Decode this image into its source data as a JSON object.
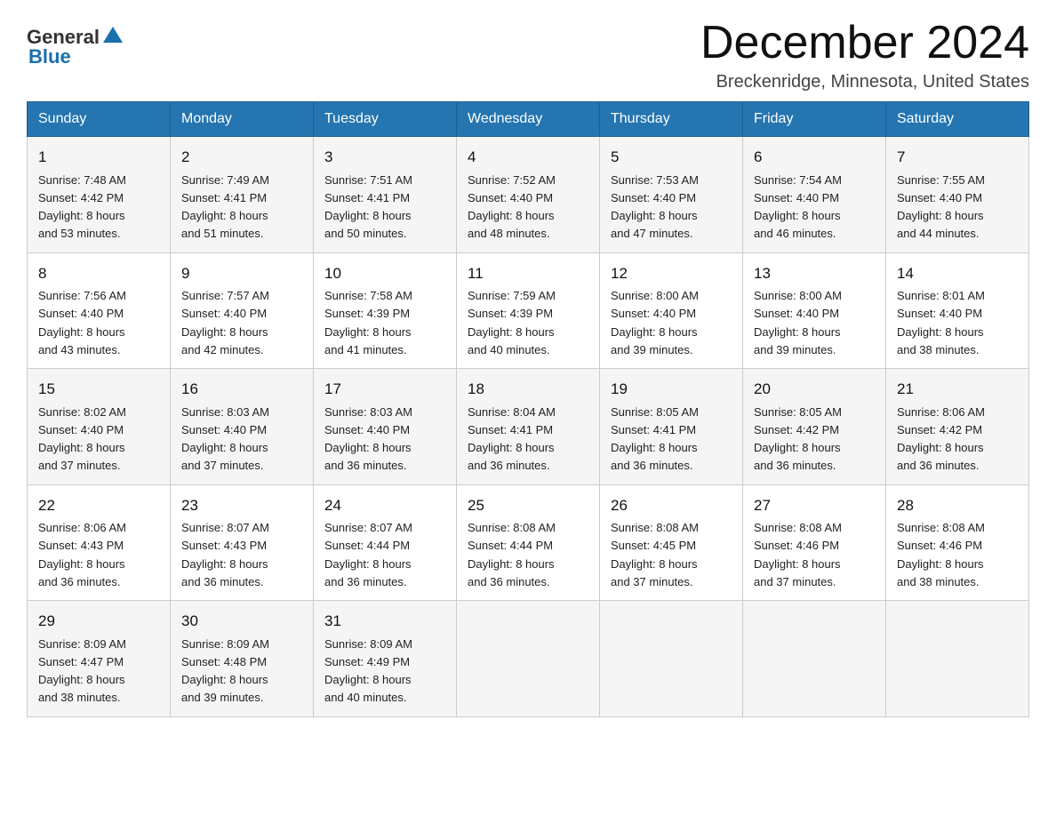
{
  "logo": {
    "general": "General",
    "blue": "Blue"
  },
  "title": "December 2024",
  "location": "Breckenridge, Minnesota, United States",
  "days_of_week": [
    "Sunday",
    "Monday",
    "Tuesday",
    "Wednesday",
    "Thursday",
    "Friday",
    "Saturday"
  ],
  "weeks": [
    [
      {
        "day": "1",
        "sunrise": "7:48 AM",
        "sunset": "4:42 PM",
        "daylight": "8 hours and 53 minutes."
      },
      {
        "day": "2",
        "sunrise": "7:49 AM",
        "sunset": "4:41 PM",
        "daylight": "8 hours and 51 minutes."
      },
      {
        "day": "3",
        "sunrise": "7:51 AM",
        "sunset": "4:41 PM",
        "daylight": "8 hours and 50 minutes."
      },
      {
        "day": "4",
        "sunrise": "7:52 AM",
        "sunset": "4:40 PM",
        "daylight": "8 hours and 48 minutes."
      },
      {
        "day": "5",
        "sunrise": "7:53 AM",
        "sunset": "4:40 PM",
        "daylight": "8 hours and 47 minutes."
      },
      {
        "day": "6",
        "sunrise": "7:54 AM",
        "sunset": "4:40 PM",
        "daylight": "8 hours and 46 minutes."
      },
      {
        "day": "7",
        "sunrise": "7:55 AM",
        "sunset": "4:40 PM",
        "daylight": "8 hours and 44 minutes."
      }
    ],
    [
      {
        "day": "8",
        "sunrise": "7:56 AM",
        "sunset": "4:40 PM",
        "daylight": "8 hours and 43 minutes."
      },
      {
        "day": "9",
        "sunrise": "7:57 AM",
        "sunset": "4:40 PM",
        "daylight": "8 hours and 42 minutes."
      },
      {
        "day": "10",
        "sunrise": "7:58 AM",
        "sunset": "4:39 PM",
        "daylight": "8 hours and 41 minutes."
      },
      {
        "day": "11",
        "sunrise": "7:59 AM",
        "sunset": "4:39 PM",
        "daylight": "8 hours and 40 minutes."
      },
      {
        "day": "12",
        "sunrise": "8:00 AM",
        "sunset": "4:40 PM",
        "daylight": "8 hours and 39 minutes."
      },
      {
        "day": "13",
        "sunrise": "8:00 AM",
        "sunset": "4:40 PM",
        "daylight": "8 hours and 39 minutes."
      },
      {
        "day": "14",
        "sunrise": "8:01 AM",
        "sunset": "4:40 PM",
        "daylight": "8 hours and 38 minutes."
      }
    ],
    [
      {
        "day": "15",
        "sunrise": "8:02 AM",
        "sunset": "4:40 PM",
        "daylight": "8 hours and 37 minutes."
      },
      {
        "day": "16",
        "sunrise": "8:03 AM",
        "sunset": "4:40 PM",
        "daylight": "8 hours and 37 minutes."
      },
      {
        "day": "17",
        "sunrise": "8:03 AM",
        "sunset": "4:40 PM",
        "daylight": "8 hours and 36 minutes."
      },
      {
        "day": "18",
        "sunrise": "8:04 AM",
        "sunset": "4:41 PM",
        "daylight": "8 hours and 36 minutes."
      },
      {
        "day": "19",
        "sunrise": "8:05 AM",
        "sunset": "4:41 PM",
        "daylight": "8 hours and 36 minutes."
      },
      {
        "day": "20",
        "sunrise": "8:05 AM",
        "sunset": "4:42 PM",
        "daylight": "8 hours and 36 minutes."
      },
      {
        "day": "21",
        "sunrise": "8:06 AM",
        "sunset": "4:42 PM",
        "daylight": "8 hours and 36 minutes."
      }
    ],
    [
      {
        "day": "22",
        "sunrise": "8:06 AM",
        "sunset": "4:43 PM",
        "daylight": "8 hours and 36 minutes."
      },
      {
        "day": "23",
        "sunrise": "8:07 AM",
        "sunset": "4:43 PM",
        "daylight": "8 hours and 36 minutes."
      },
      {
        "day": "24",
        "sunrise": "8:07 AM",
        "sunset": "4:44 PM",
        "daylight": "8 hours and 36 minutes."
      },
      {
        "day": "25",
        "sunrise": "8:08 AM",
        "sunset": "4:44 PM",
        "daylight": "8 hours and 36 minutes."
      },
      {
        "day": "26",
        "sunrise": "8:08 AM",
        "sunset": "4:45 PM",
        "daylight": "8 hours and 37 minutes."
      },
      {
        "day": "27",
        "sunrise": "8:08 AM",
        "sunset": "4:46 PM",
        "daylight": "8 hours and 37 minutes."
      },
      {
        "day": "28",
        "sunrise": "8:08 AM",
        "sunset": "4:46 PM",
        "daylight": "8 hours and 38 minutes."
      }
    ],
    [
      {
        "day": "29",
        "sunrise": "8:09 AM",
        "sunset": "4:47 PM",
        "daylight": "8 hours and 38 minutes."
      },
      {
        "day": "30",
        "sunrise": "8:09 AM",
        "sunset": "4:48 PM",
        "daylight": "8 hours and 39 minutes."
      },
      {
        "day": "31",
        "sunrise": "8:09 AM",
        "sunset": "4:49 PM",
        "daylight": "8 hours and 40 minutes."
      },
      null,
      null,
      null,
      null
    ]
  ],
  "labels": {
    "sunrise": "Sunrise:",
    "sunset": "Sunset:",
    "daylight": "Daylight:"
  }
}
